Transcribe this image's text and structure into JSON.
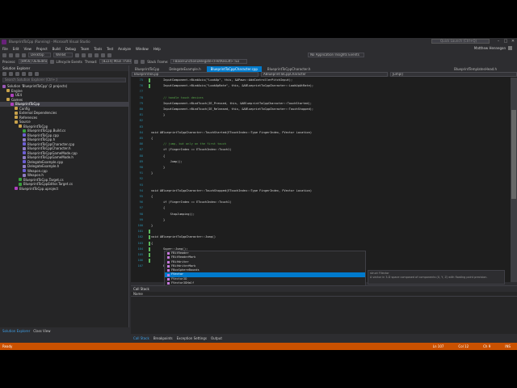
{
  "window": {
    "title": "BlueprintToCpp (Running) - Microsoft Visual Studio",
    "quick_launch": "Quick Launch (Ctrl+Q)",
    "user": "Matthew Hennegan"
  },
  "menu": [
    "File",
    "Edit",
    "View",
    "Project",
    "Build",
    "Debug",
    "Team",
    "Tools",
    "Test",
    "Analyze",
    "Window",
    "Help"
  ],
  "toolbar": {
    "config": "Desktop",
    "platform": "Win64",
    "process_label": "Process:",
    "process": "[8956] UE4Editor.exe",
    "lifecycle": "Lifecycle Events",
    "thread_label": "Thread:",
    "thread": "[8224] Main Thread",
    "stack_frame_label": "Stack Frame:",
    "stack_frame": "FBaseFunctionDelegate<FHitResult>::Ex",
    "insights": "No Application Insights Events"
  },
  "solution_explorer": {
    "title": "Solution Explorer",
    "search": "Search Solution Explorer (Ctrl+;)",
    "items": [
      {
        "label": "Solution 'BlueprintToCpp' (2 projects)",
        "indent": 0,
        "icon": "ic-sln"
      },
      {
        "label": "Engine",
        "indent": 1,
        "icon": "ic-fold"
      },
      {
        "label": "UE4",
        "indent": 2,
        "icon": "ic-proj"
      },
      {
        "label": "Games",
        "indent": 1,
        "icon": "ic-fold"
      },
      {
        "label": "BlueprintToCpp",
        "indent": 2,
        "icon": "ic-proj",
        "selected": true
      },
      {
        "label": "Config",
        "indent": 3,
        "icon": "ic-fold"
      },
      {
        "label": "External Dependencies",
        "indent": 3,
        "icon": "ic-fold"
      },
      {
        "label": "References",
        "indent": 3,
        "icon": "ic-fold"
      },
      {
        "label": "Source",
        "indent": 3,
        "icon": "ic-fold"
      },
      {
        "label": "BlueprintToCpp",
        "indent": 4,
        "icon": "ic-fold"
      },
      {
        "label": "BlueprintToCpp.Build.cs",
        "indent": 5,
        "icon": "ic-cs"
      },
      {
        "label": "BlueprintToCpp.cpp",
        "indent": 5,
        "icon": "ic-cpp"
      },
      {
        "label": "BlueprintToCpp.h",
        "indent": 5,
        "icon": "ic-h"
      },
      {
        "label": "BlueprintToCppCharacter.cpp",
        "indent": 5,
        "icon": "ic-cpp"
      },
      {
        "label": "BlueprintToCppCharacter.h",
        "indent": 5,
        "icon": "ic-h"
      },
      {
        "label": "BlueprintToCppGameMode.cpp",
        "indent": 5,
        "icon": "ic-cpp"
      },
      {
        "label": "BlueprintToCppGameMode.h",
        "indent": 5,
        "icon": "ic-h"
      },
      {
        "label": "DelegateExample.cpp",
        "indent": 5,
        "icon": "ic-cpp"
      },
      {
        "label": "DelegateExample.h",
        "indent": 5,
        "icon": "ic-h"
      },
      {
        "label": "Weapon.cpp",
        "indent": 5,
        "icon": "ic-cpp"
      },
      {
        "label": "Weapon.h",
        "indent": 5,
        "icon": "ic-h"
      },
      {
        "label": "BlueprintToCpp.Target.cs",
        "indent": 4,
        "icon": "ic-cs"
      },
      {
        "label": "BlueprintToCppEditor.Target.cs",
        "indent": 4,
        "icon": "ic-cs"
      },
      {
        "label": "BlueprintToCpp.uproject",
        "indent": 3,
        "icon": "ic-proj"
      }
    ],
    "tabs": [
      "Solution Explorer",
      "Class View"
    ]
  },
  "editor": {
    "tabs": [
      "BlueprintToCpp",
      "DelegateExample.h",
      "BlueprintToCppCharacter.cpp",
      "BlueprintToCppCharacter.h"
    ],
    "active_tab": 2,
    "right_tab": "BlueprintTemplatesHead.h",
    "nav": [
      "BlueprintToCpp",
      "ABlueprintToCppCharacter",
      "Jump()"
    ],
    "lines": [
      {
        "n": "75",
        "t": "InputComponent->BindAxis(\"LookUp\", this, &APawn::AddControllerPitchInput);"
      },
      {
        "n": "76",
        "t": "InputComponent->BindAxis(\"LookUpRate\", this, &ABlueprintToCppCharacter::LookUpAtRate);"
      },
      {
        "n": "77",
        "t": ""
      },
      {
        "n": "78",
        "t": "// handle touch devices",
        "c": "cm"
      },
      {
        "n": "79",
        "t": "InputComponent->BindTouch(IE_Pressed, this, &ABlueprintToCppCharacter::TouchStarted);"
      },
      {
        "n": "80",
        "t": "InputComponent->BindTouch(IE_Released, this, &ABlueprintToCppCharacter::TouchStopped);"
      },
      {
        "n": "81",
        "t": "}"
      },
      {
        "n": "82",
        "t": ""
      },
      {
        "n": "83",
        "t": ""
      },
      {
        "n": "84",
        "t": "void ABlueprintToCppCharacter::TouchStarted(ETouchIndex::Type FingerIndex, FVector Location)",
        "x": -15
      },
      {
        "n": "85",
        "t": "{",
        "x": -15
      },
      {
        "n": "86",
        "t": "// jump, but only on the first touch",
        "c": "cm"
      },
      {
        "n": "87",
        "t": "if (FingerIndex == ETouchIndex::Touch1)"
      },
      {
        "n": "88",
        "t": "{"
      },
      {
        "n": "89",
        "t": "    Jump();"
      },
      {
        "n": "90",
        "t": "}"
      },
      {
        "n": "91",
        "t": "}",
        "x": -15
      },
      {
        "n": "92",
        "t": ""
      },
      {
        "n": "93",
        "t": ""
      },
      {
        "n": "94",
        "t": "void ABlueprintToCppCharacter::TouchStopped(ETouchIndex::Type FingerIndex, FVector Location)",
        "x": -15
      },
      {
        "n": "95",
        "t": "{",
        "x": -15
      },
      {
        "n": "96",
        "t": "if (FingerIndex == ETouchIndex::Touch1)"
      },
      {
        "n": "97",
        "t": "{"
      },
      {
        "n": "98",
        "t": "    StopJumping();"
      },
      {
        "n": "99",
        "t": "}"
      },
      {
        "n": "100",
        "t": "}",
        "x": -15
      },
      {
        "n": "101",
        "t": ""
      },
      {
        "n": "102",
        "t": "void ABlueprintToCppCharacter::Jump()",
        "x": -15
      },
      {
        "n": "103",
        "t": "{",
        "x": -15
      },
      {
        "n": "104",
        "t": "Super::Jump();"
      },
      {
        "n": "105",
        "t": ""
      },
      {
        "n": "106",
        "t": ""
      },
      {
        "n": "107",
        "t": "FVector"
      }
    ]
  },
  "intellisense": {
    "items": [
      "FBitReader",
      "FBitReaderMark",
      "FBitWriter",
      "FBitWriterMark",
      "FBoxSphereBounds",
      "FVector",
      "FVector2D",
      "FVector2DHalf",
      "FVector4",
      "FVectorDistributor",
      "FVectorDistributorDraw",
      "FVectorHalf"
    ],
    "selected": 5,
    "tooltip": "struct FVector",
    "tooltip_detail": "A vector in 3-D space composed of components (X, Y, Z) with floating point precision."
  },
  "call_stack": {
    "title": "Call Stack",
    "columns": "Name"
  },
  "bottom_tabs": [
    "Call Stack",
    "Breakpoints",
    "Exception Settings",
    "Output"
  ],
  "status": {
    "left": "Ready",
    "ln": "Ln 107",
    "col": "Col 12",
    "ch": "Ch 9",
    "mode": "INS"
  }
}
